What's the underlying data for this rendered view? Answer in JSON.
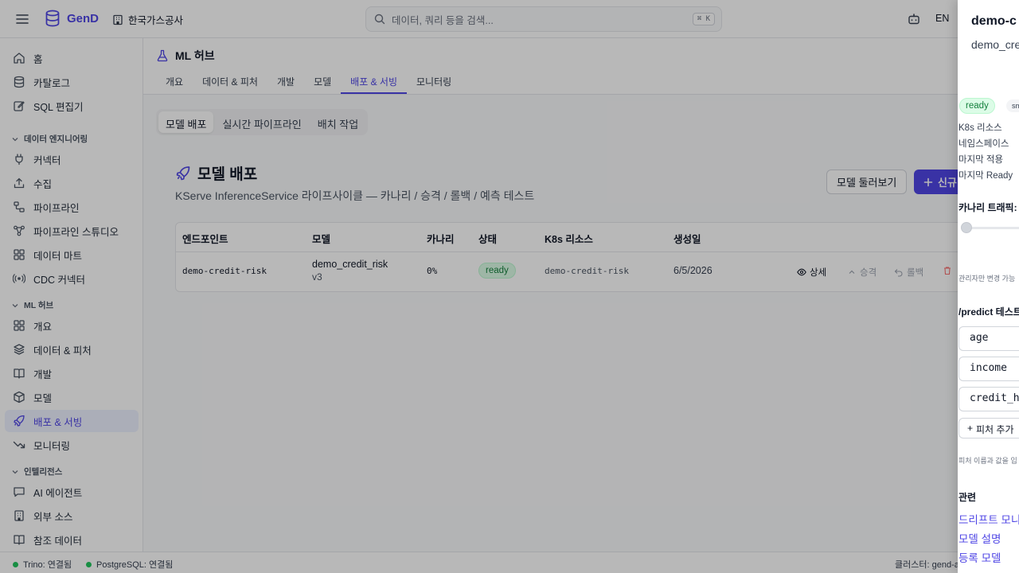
{
  "header": {
    "app_name": "GenD",
    "org_name": "한국가스공사",
    "search_placeholder": "데이터, 쿼리 등을 검색...",
    "search_shortcut": "⌘ K",
    "language": "EN"
  },
  "sidebar": {
    "top_items": [
      {
        "label": "홈",
        "icon": "home-icon"
      },
      {
        "label": "카탈로그",
        "icon": "database-icon"
      },
      {
        "label": "SQL 편집기",
        "icon": "edit-icon"
      }
    ],
    "sections": [
      {
        "label": "데이터 엔지니어링",
        "items": [
          {
            "label": "커넥터",
            "icon": "plug-icon"
          },
          {
            "label": "수집",
            "icon": "upload-icon"
          },
          {
            "label": "파이프라인",
            "icon": "workflow-icon"
          },
          {
            "label": "파이프라인 스튜디오",
            "icon": "studio-icon"
          },
          {
            "label": "데이터 마트",
            "icon": "grid-icon"
          },
          {
            "label": "CDC 커넥터",
            "icon": "radio-icon"
          }
        ]
      },
      {
        "label": "ML 허브",
        "items": [
          {
            "label": "개요",
            "icon": "grid-icon"
          },
          {
            "label": "데이터 & 피처",
            "icon": "layers-icon"
          },
          {
            "label": "개발",
            "icon": "book-icon"
          },
          {
            "label": "모델",
            "icon": "box-icon"
          },
          {
            "label": "배포 & 서빙",
            "icon": "rocket-icon",
            "active": true
          },
          {
            "label": "모니터링",
            "icon": "trending-down-icon"
          }
        ]
      },
      {
        "label": "인텔리전스",
        "items": [
          {
            "label": "AI 에이전트",
            "icon": "message-icon"
          },
          {
            "label": "외부 소스",
            "icon": "building-icon"
          },
          {
            "label": "참조 데이터",
            "icon": "book-icon"
          }
        ]
      }
    ]
  },
  "page": {
    "title": "ML 허브",
    "tabs": [
      {
        "label": "개요"
      },
      {
        "label": "데이터 & 피처"
      },
      {
        "label": "개발"
      },
      {
        "label": "모델"
      },
      {
        "label": "배포 & 서빙",
        "active": true
      },
      {
        "label": "모니터링"
      }
    ],
    "segments": [
      {
        "label": "모델 배포",
        "active": true
      },
      {
        "label": "실시간 파이프라인"
      },
      {
        "label": "배치 작업"
      }
    ],
    "section_title": "모델 배포",
    "section_subtitle": "KServe InferenceService 라이프사이클 — 카나리 / 승격 / 롤백 / 예측 테스트",
    "browse_button": "모델 둘러보기",
    "new_button": "신규",
    "table": {
      "headers": [
        "엔드포인트",
        "모델",
        "카나리",
        "상태",
        "K8s 리소스",
        "생성일"
      ],
      "rows": [
        {
          "endpoint": "demo-credit-risk",
          "model": "demo_credit_risk",
          "version": "v3",
          "canary": "0%",
          "status": "ready",
          "k8s": "demo-credit-risk",
          "created": "6/5/2026",
          "actions": {
            "detail": "상세",
            "promote": "승격",
            "rollback": "롤백"
          }
        }
      ]
    }
  },
  "statusbar": {
    "trino": "Trino: 연결됨",
    "postgres": "PostgreSQL: 연결됨",
    "cluster": "클러스터: gend-a"
  },
  "drawer": {
    "title": "demo-c",
    "subtitle": "demo_cre",
    "badge_ready": "ready",
    "badge_second": "sm",
    "rows": [
      "K8s 리소스",
      "네임스페이스",
      "마지막 적용",
      "마지막 Ready"
    ],
    "canary_label": "카나리 트래픽: 0",
    "admin_note": "관리자만 변경 가능",
    "predict_label": "/predict 테스트",
    "inputs": [
      "age",
      "income",
      "credit_h"
    ],
    "add_feature": "피처 추가",
    "feature_hint": "피처 이름과 값을 입",
    "related_label": "관련",
    "links": [
      "드리프트 모니",
      "모델 설명",
      "등록 모델"
    ]
  }
}
